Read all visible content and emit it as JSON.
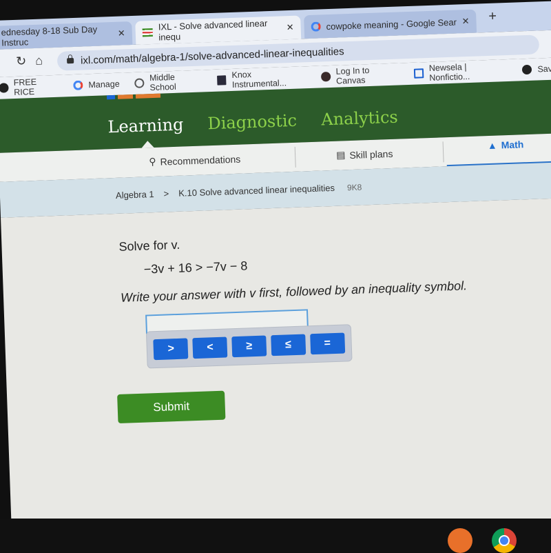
{
  "browser": {
    "tabs": [
      {
        "title": "ednesday 8-18 Sub Day Instruc",
        "active": false,
        "close": "✕"
      },
      {
        "title": "IXL - Solve advanced linear inequ",
        "active": true,
        "close": "✕"
      },
      {
        "title": "cowpoke meaning - Google Sear",
        "active": false,
        "close": "✕"
      }
    ],
    "new_tab": "+",
    "url": "ixl.com/math/algebra-1/solve-advanced-linear-inequalities",
    "bookmarks": [
      {
        "label": "FREE RICE",
        "icon": "circle-icon"
      },
      {
        "label": "Manage",
        "icon": "google-icon"
      },
      {
        "label": "Middle School",
        "icon": "school-logo-icon"
      },
      {
        "label": "Knox Instrumental...",
        "icon": "table-icon"
      },
      {
        "label": "Log In to Canvas",
        "icon": "canvas-icon"
      },
      {
        "label": "Newsela | Nonfictio...",
        "icon": "newsela-icon"
      },
      {
        "label": "Sav",
        "icon": "save-icon"
      }
    ]
  },
  "ixl": {
    "nav": {
      "learning": "Learning",
      "diagnostic": "Diagnostic",
      "analytics": "Analytics"
    },
    "subnav": {
      "recommendations": "Recommendations",
      "skill_plans": "Skill plans",
      "math": "Math"
    },
    "breadcrumb": {
      "subject": "Algebra 1",
      "separator": ">",
      "skill": "K.10 Solve advanced linear inequalities",
      "code": "9K8"
    },
    "colors": {
      "header_green": "#2c5b2a",
      "nav_green": "#8dd14a",
      "button_blue": "#1a66d6",
      "submit_green": "#3c8c24",
      "math_blue": "#1f6fd0"
    }
  },
  "question": {
    "prompt": "Solve for v.",
    "equation": "−3v + 16 > −7v − 8",
    "instruction": "Write your answer with v first, followed by an inequality symbol.",
    "answer_value": "",
    "symbols": [
      ">",
      "<",
      "≥",
      "≤",
      "="
    ],
    "submit": "Submit"
  },
  "shelf": {
    "apps": [
      "share-icon",
      "chrome-icon"
    ]
  }
}
